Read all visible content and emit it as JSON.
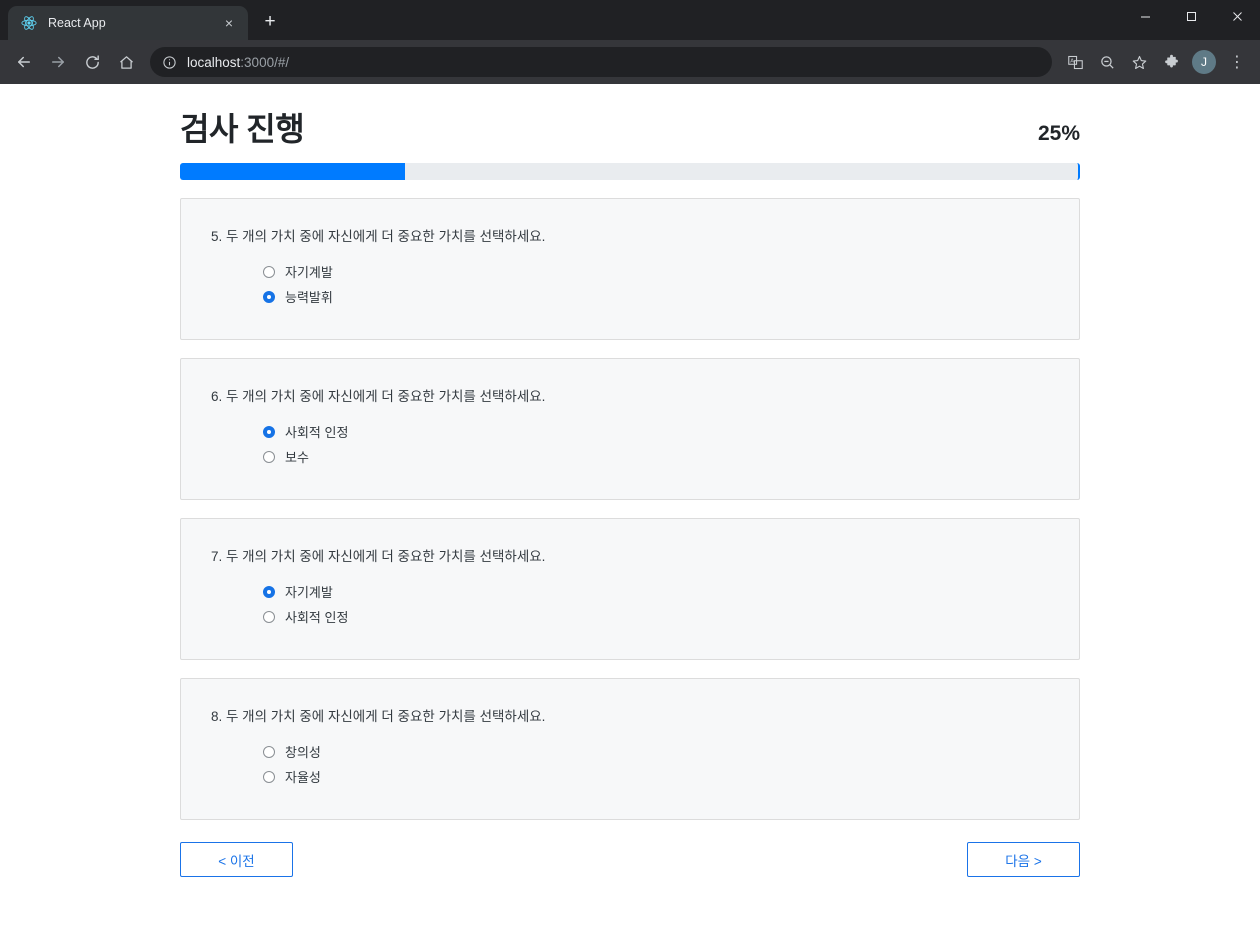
{
  "browser": {
    "tab": {
      "title": "React App",
      "favicon_icon": "react-logo-icon",
      "close_icon": "×"
    },
    "new_tab_label": "+",
    "window_controls": {
      "minimize": "—",
      "maximize": "☐",
      "close": "✕"
    },
    "nav": {
      "back_icon": "←",
      "forward_icon": "→",
      "reload_icon": "⟳",
      "home_icon": "⌂"
    },
    "omnibox": {
      "info_icon": "ⓘ",
      "url_host": "localhost",
      "url_rest": ":3000/#/"
    },
    "toolbar_icons": [
      {
        "name": "translate-icon",
        "glyph": "文"
      },
      {
        "name": "zoom-search-icon",
        "glyph": "⌕"
      },
      {
        "name": "bookmark-star-icon",
        "glyph": "☆"
      },
      {
        "name": "extensions-puzzle-icon",
        "glyph": "🧩"
      }
    ],
    "avatar_initial": "J",
    "menu_icon": "⋮"
  },
  "page": {
    "title": "검사 진행",
    "percent_label": "25%",
    "progress_value": 25,
    "accent_color": "#007bff",
    "questions": [
      {
        "number": "5.",
        "text": "두 개의 가치 중에 자신에게 더 중요한 가치를 선택하세요.",
        "full_text": "5. 두 개의 가치 중에 자신에게 더 중요한 가치를 선택하세요.",
        "options": [
          {
            "label": "자기계발",
            "selected": false
          },
          {
            "label": "능력발휘",
            "selected": true
          }
        ]
      },
      {
        "number": "6.",
        "text": "두 개의 가치 중에 자신에게 더 중요한 가치를 선택하세요.",
        "full_text": "6. 두 개의 가치 중에 자신에게 더 중요한 가치를 선택하세요.",
        "options": [
          {
            "label": "사회적 인정",
            "selected": true
          },
          {
            "label": "보수",
            "selected": false
          }
        ]
      },
      {
        "number": "7.",
        "text": "두 개의 가치 중에 자신에게 더 중요한 가치를 선택하세요.",
        "full_text": "7. 두 개의 가치 중에 자신에게 더 중요한 가치를 선택하세요.",
        "options": [
          {
            "label": "자기계발",
            "selected": true
          },
          {
            "label": "사회적 인정",
            "selected": false
          }
        ]
      },
      {
        "number": "8.",
        "text": "두 개의 가치 중에 자신에게 더 중요한 가치를 선택하세요.",
        "full_text": "8. 두 개의 가치 중에 자신에게 더 중요한 가치를 선택하세요.",
        "options": [
          {
            "label": "창의성",
            "selected": false
          },
          {
            "label": "자율성",
            "selected": false
          }
        ]
      }
    ],
    "prev_button": "< 이전",
    "next_button": "다음 >"
  }
}
